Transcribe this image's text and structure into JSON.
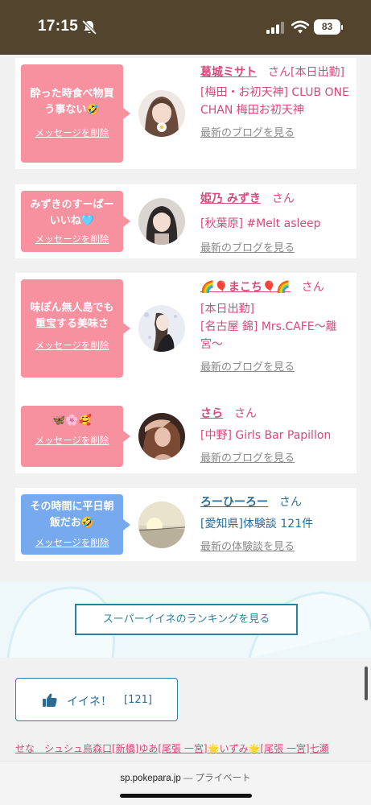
{
  "status_bar": {
    "time": "17:15",
    "battery": "83"
  },
  "cards": [
    {
      "message": "酔った時食べ物買う事ない🤣",
      "delete_label": "メッセージを削除",
      "name": "葛城ミサト",
      "honorific": "さん",
      "status": "[本日出勤]",
      "location": "[梅田・お初天神] CLUB ONE CHAN 梅田お初天神",
      "link": "最新のブログを見る",
      "bubble_color": "#f7909f"
    },
    {
      "message": "みずきのすーぱーいいね🩵",
      "delete_label": "メッセージを削除",
      "name": "姫乃 みずき",
      "honorific": "さん",
      "location": "[秋葉原] #Melt asleep",
      "link": "最新のブログを見る",
      "bubble_color": "#f7909f"
    },
    {
      "message": "味ぽん無人島でも重宝する美味さ",
      "delete_label": "メッセージを削除",
      "name": "🌈🎈まこち🎈🌈",
      "honorific": "さん",
      "status": "[本日出勤]",
      "location": "[名古屋 錦] Mrs.CAFE〜離宮〜",
      "link": "最新のブログを見る",
      "bubble_color": "#f7909f"
    },
    {
      "message": "🦋🌸🥰",
      "delete_label": "メッセージを削除",
      "name": "さら",
      "honorific": "さん",
      "location": "[中野] Girls Bar Papillon",
      "link": "最新のブログを見る",
      "bubble_color": "#f7909f"
    },
    {
      "message": "その時間に平日朝飯だお🤣",
      "delete_label": "メッセージを削除",
      "name": "ろーひーろー",
      "honorific": "さん",
      "location": "[愛知県]体験談 121件",
      "link": "最新の体験談を見る",
      "bubble_color": "#76a9ee"
    }
  ],
  "ranking_button": "スーパーイイネのランキングを見る",
  "like_button": {
    "label": "イイネ！",
    "count": "[121]"
  },
  "links_line": "せな　シュシュ烏森口[新橋]ゆあ[尾張 一宮]🌟いずみ🌟[尾張 一宮]七瀬",
  "browser": {
    "domain": "sp.pokepara.jp",
    "separator": "—",
    "mode": "プライベート"
  },
  "colors": {
    "accent_pink": "#d9487a",
    "accent_blue": "#2c6b93",
    "status_bar": "#53442e"
  }
}
